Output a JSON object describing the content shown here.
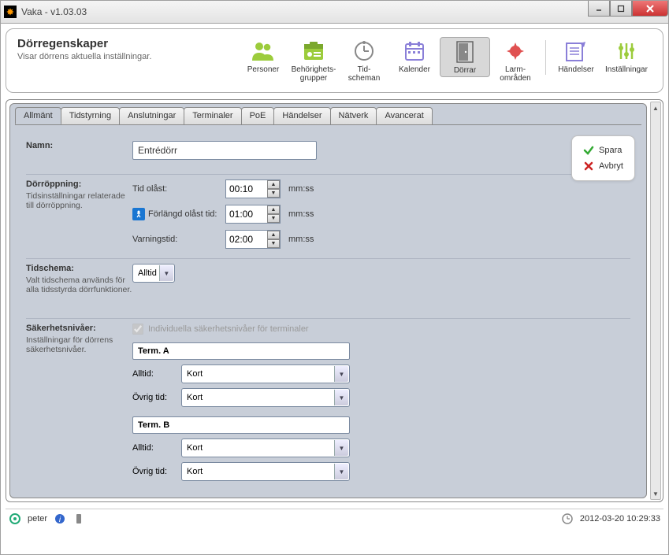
{
  "window": {
    "title": "Vaka - v1.03.03"
  },
  "ribbon": {
    "heading": "Dörregenskaper",
    "sub": "Visar dörrens aktuella inställningar.",
    "items": [
      {
        "label1": "Personer",
        "label2": ""
      },
      {
        "label1": "Behörighets-",
        "label2": "grupper"
      },
      {
        "label1": "Tid-",
        "label2": "scheman"
      },
      {
        "label1": "Kalender",
        "label2": ""
      },
      {
        "label1": "Dörrar",
        "label2": ""
      },
      {
        "label1": "Larm-",
        "label2": "områden"
      },
      {
        "label1": "Händelser",
        "label2": ""
      },
      {
        "label1": "Inställningar",
        "label2": ""
      }
    ]
  },
  "tabs": [
    "Allmänt",
    "Tidstyrning",
    "Anslutningar",
    "Terminaler",
    "PoE",
    "Händelser",
    "Nätverk",
    "Avancerat"
  ],
  "form": {
    "name_label": "Namn:",
    "name_value": "Entrédörr",
    "open": {
      "heading": "Dörröppning:",
      "desc": "Tidsinställningar relaterade till dörröppning.",
      "time_unlocked_label": "Tid olåst:",
      "time_unlocked_value": "00:10",
      "extended_label": "Förlängd olåst tid:",
      "extended_value": "01:00",
      "warn_label": "Varningstid:",
      "warn_value": "02:00",
      "unit": "mm:ss"
    },
    "schedule": {
      "heading": "Tidschema:",
      "desc": "Valt tidschema används för alla tidsstyrda dörrfunktioner.",
      "value": "Alltid"
    },
    "security": {
      "heading": "Säkerhetsnivåer:",
      "desc": "Inställningar för dörrens säkerhetsnivåer.",
      "checkbox_label": "Individuella säkerhetsnivåer för terminaler",
      "terminals": [
        {
          "name": "Term. A",
          "alltid_label": "Alltid:",
          "alltid": "Kort",
          "ovrig_label": "Övrig tid:",
          "ovrig": "Kort"
        },
        {
          "name": "Term. B",
          "alltid_label": "Alltid:",
          "alltid": "Kort",
          "ovrig_label": "Övrig tid:",
          "ovrig": "Kort"
        }
      ]
    }
  },
  "actions": {
    "save": "Spara",
    "cancel": "Avbryt"
  },
  "status": {
    "user": "peter",
    "datetime": "2012-03-20 10:29:33"
  }
}
